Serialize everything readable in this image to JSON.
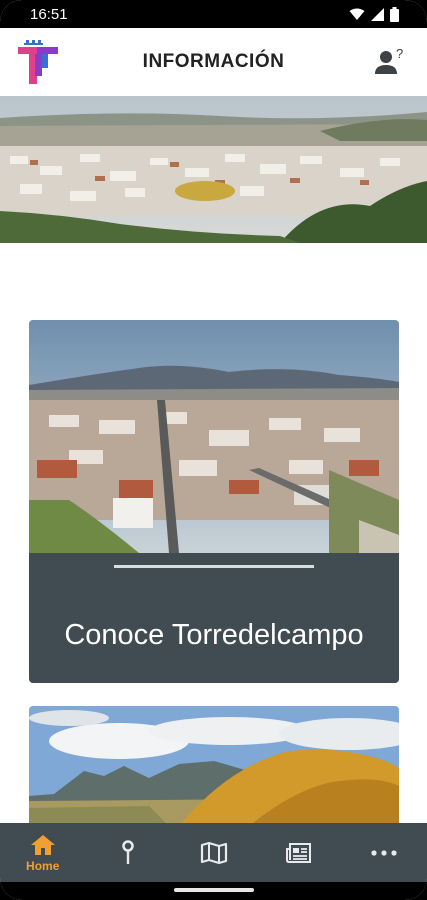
{
  "status_bar": {
    "time": "16:51",
    "icons": [
      "wifi-icon",
      "signal-icon",
      "battery-icon"
    ]
  },
  "header": {
    "title": "INFORMACIÓN",
    "logo": "app-logo-t",
    "right_icon": "user-help-icon"
  },
  "hero": {
    "image": "town-panorama"
  },
  "cards": [
    {
      "title": "Conoce Torredelcampo",
      "image": "aerial-town-view"
    },
    {
      "title": "",
      "image": "mountain-landscape"
    }
  ],
  "bottom_nav": {
    "items": [
      {
        "label": "Home",
        "icon": "home-icon",
        "active": true
      },
      {
        "label": "",
        "icon": "pin-icon"
      },
      {
        "label": "",
        "icon": "map-icon"
      },
      {
        "label": "",
        "icon": "news-icon"
      },
      {
        "label": "",
        "icon": "more-icon"
      }
    ]
  },
  "colors": {
    "accent": "#f0a030",
    "nav_background": "#414b52",
    "caption_background": "#414b52"
  }
}
